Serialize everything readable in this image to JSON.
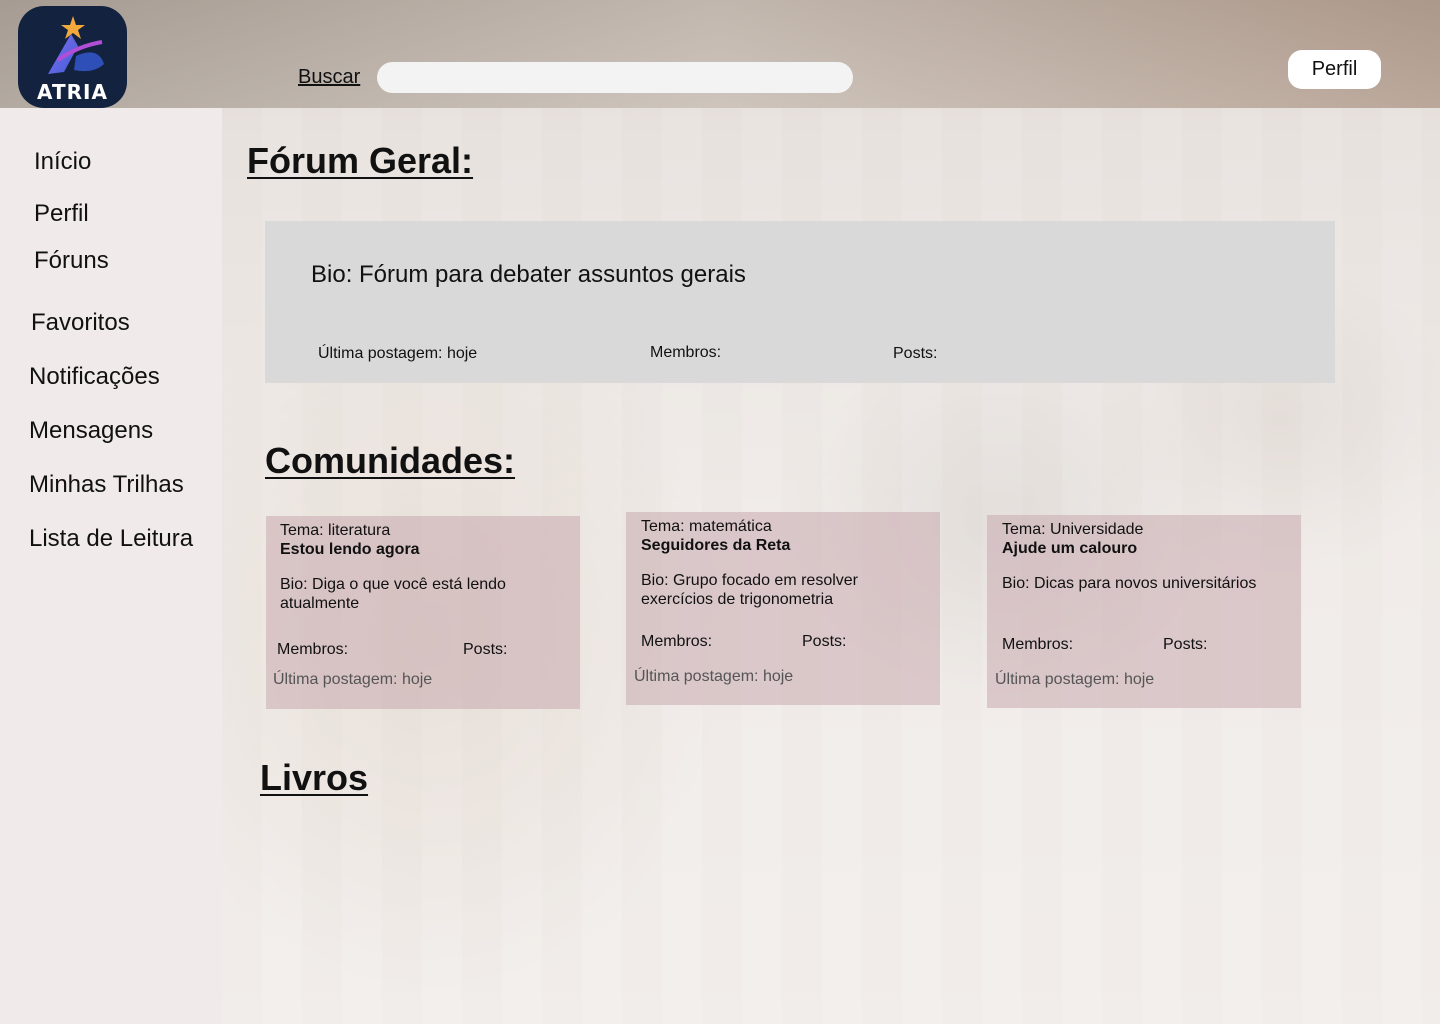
{
  "app": {
    "logo_text": "ATRIA"
  },
  "header": {
    "search_label": "Buscar",
    "search_value": "",
    "profile_button": "Perfil"
  },
  "sidebar": {
    "items": [
      {
        "label": "Início"
      },
      {
        "label": "Perfil"
      },
      {
        "label": "Fóruns"
      },
      {
        "label": "Favoritos"
      },
      {
        "label": "Notificações"
      },
      {
        "label": "Mensagens"
      },
      {
        "label": "Minhas Trilhas"
      },
      {
        "label": "Lista de Leitura"
      }
    ]
  },
  "forum_geral": {
    "title": "Fórum Geral:",
    "bio": "Bio: Fórum para debater assuntos gerais",
    "last_post": "Última postagem: hoje",
    "members": "Membros:",
    "posts": "Posts:"
  },
  "comunidades": {
    "title": "Comunidades:",
    "items": [
      {
        "theme": "Tema: literatura",
        "name": "Estou lendo agora",
        "bio": "Bio: Diga o que você está lendo atualmente",
        "members": "Membros:",
        "posts": "Posts:",
        "last_post": "Última postagem: hoje"
      },
      {
        "theme": "Tema: matemática",
        "name": "Seguidores da Reta",
        "bio": "Bio: Grupo focado em resolver exercícios de trigonometria",
        "members": "Membros:",
        "posts": "Posts:",
        "last_post": "Última postagem: hoje"
      },
      {
        "theme": "Tema: Universidade",
        "name": "Ajude um calouro",
        "bio": "Bio: Dicas para novos universitários",
        "members": "Membros:",
        "posts": "Posts:",
        "last_post": "Última postagem: hoje"
      }
    ]
  },
  "livros": {
    "title": "Livros"
  },
  "colors": {
    "logo_bg": "#13233f",
    "sidebar_bg": "#f0eaea",
    "forum_card_bg": "#d9d9d9",
    "community_card_bg": "#c8aaaf"
  }
}
